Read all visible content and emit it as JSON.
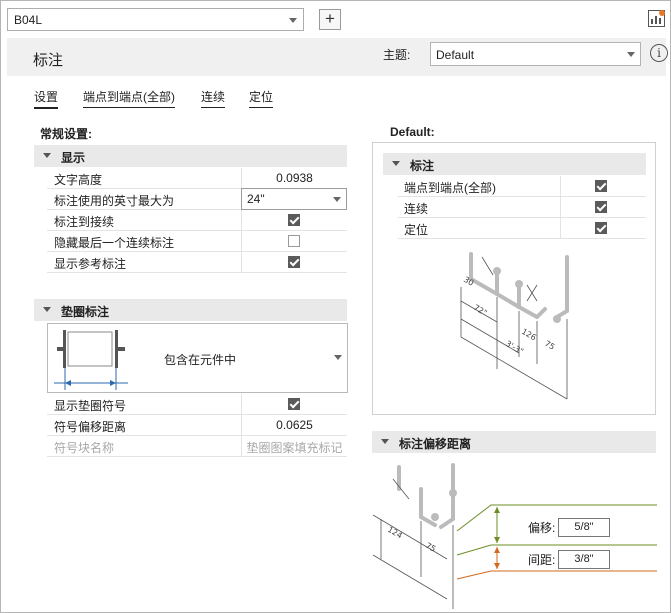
{
  "toolbar": {
    "standard_value": "B04L",
    "add_label": "+",
    "report_icon": "report-icon"
  },
  "header": {
    "title": "标注",
    "theme_label": "主题:",
    "theme_value": "Default",
    "info_glyph": "i"
  },
  "tabs": [
    {
      "label": "设置",
      "active": true
    },
    {
      "label": "端点到端点(全部)",
      "active": false
    },
    {
      "label": "连续",
      "active": false
    },
    {
      "label": "定位",
      "active": false
    }
  ],
  "general": {
    "heading": "常规设置:",
    "display_group": {
      "title": "显示",
      "rows": [
        {
          "label": "文字高度",
          "value": "0.0938"
        },
        {
          "label": "标注使用的英寸最大为",
          "value": "24\""
        },
        {
          "label": "标注到接续",
          "checked": true
        },
        {
          "label": "隐藏最后一个连续标注",
          "checked": false
        },
        {
          "label": "显示参考标注",
          "checked": true
        }
      ]
    },
    "shim_group": {
      "title": "垫圈标注",
      "style_label": "包含在元件中",
      "rows": [
        {
          "label": "显示垫圈符号",
          "checked": true
        },
        {
          "label": "符号偏移距离",
          "value": "0.0625"
        },
        {
          "label": "符号块名称",
          "value": "垫圈图案填充标记"
        }
      ]
    }
  },
  "defaults": {
    "heading": "Default:",
    "group_title": "标注",
    "rows": [
      {
        "label": "端点到端点(全部)",
        "checked": true
      },
      {
        "label": "连续",
        "checked": true
      },
      {
        "label": "定位",
        "checked": true
      }
    ],
    "drawing_dims": [
      "30",
      "72\"",
      "3'-3\"",
      "126",
      "75"
    ]
  },
  "offset_section": {
    "title": "标注偏移距离",
    "drawing_dims": [
      "124",
      "75"
    ],
    "offset_label": "偏移:",
    "offset_value": "5/8\"",
    "spacing_label": "间距:",
    "spacing_value": "3/8\""
  },
  "colors": {
    "offset_line": "#6b8e23",
    "spacing_line": "#d2691e",
    "checkbox_fill": "#5a5a5a",
    "group_header": "#e9e9e9"
  }
}
